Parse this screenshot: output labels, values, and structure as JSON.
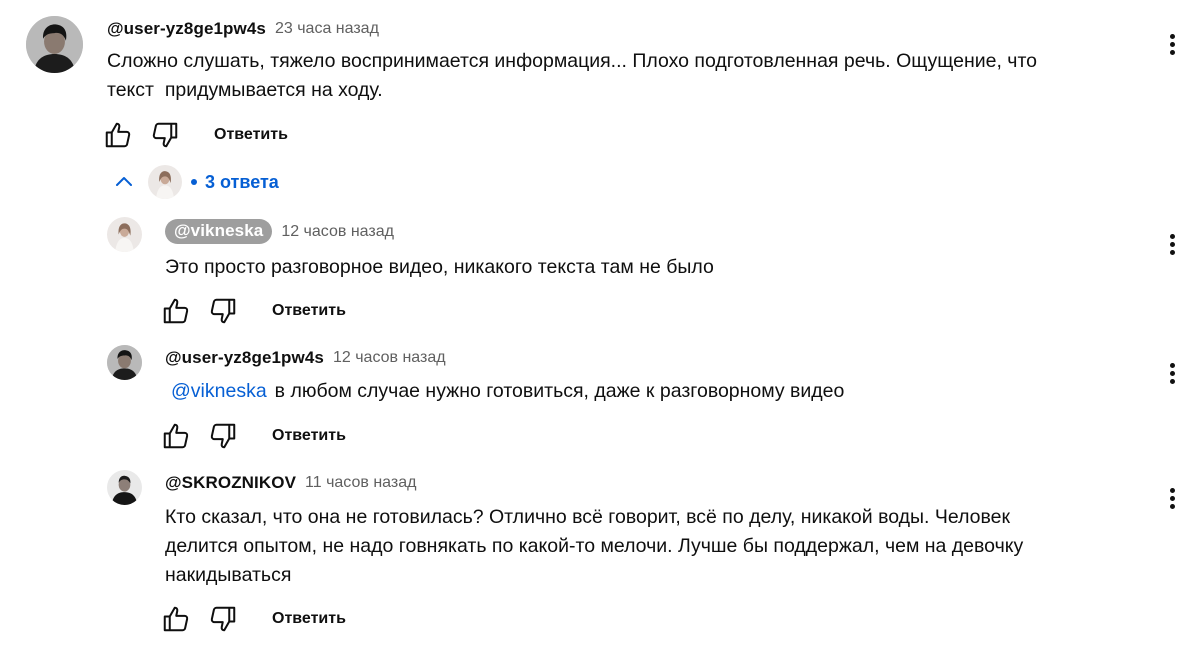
{
  "comment": {
    "author": "@user-yz8ge1pw4s",
    "time": "23 часа назад",
    "text": "Сложно слушать, тяжело воспринимается информация... Плохо подготовленная речь. Ощущение, что\nтекст  придумывается на ходу.",
    "reply_label": "Ответить"
  },
  "replies_toggle": {
    "label": "3 ответа"
  },
  "replies": [
    {
      "author": "@vikneska",
      "time": "12 часов назад",
      "text": "Это просто разговорное видео, никакого текста там не было",
      "reply_label": "Ответить"
    },
    {
      "author": "@user-yz8ge1pw4s",
      "time": "12 часов назад",
      "mention": "@vikneska",
      "text": "в любом случае нужно готовиться, даже к разговорному видео",
      "reply_label": "Ответить"
    },
    {
      "author": "@SKROZNIKOV",
      "time": "11 часов назад",
      "text": "Кто сказал, что она не готовилась? Отлично всё говорит, всё по делу, никакой воды. Человек\nделится опытом, не надо говнякать по какой-то мелочи. Лучше бы поддержал, чем на девочку\nнакидываться",
      "reply_label": "Ответить"
    }
  ],
  "colors": {
    "link": "#065fd4",
    "meta": "#606060",
    "chip": "#9e9e9e"
  },
  "icons": [
    "like-icon",
    "dislike-icon",
    "more-vert-icon",
    "chevron-up-icon"
  ]
}
